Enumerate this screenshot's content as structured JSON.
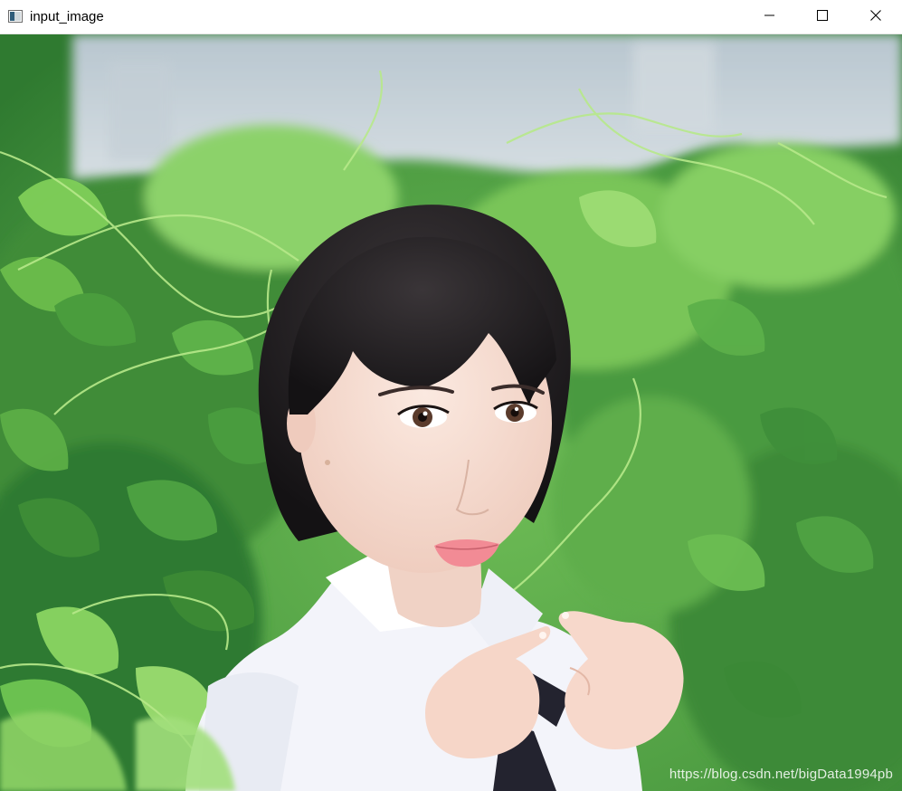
{
  "window": {
    "title": "input_image",
    "app_icon": "image-window-icon",
    "controls": {
      "minimize_icon": "minimize-icon",
      "maximize_icon": "maximize-icon",
      "close_icon": "close-icon"
    }
  },
  "image": {
    "subject": "photo",
    "watermark": "https://blog.csdn.net/bigData1994pb"
  },
  "colors": {
    "foliage_dark": "#3f8f3a",
    "foliage_light": "#8fd36a",
    "hair": "#1e1b1f",
    "skin": "#f7dcd0",
    "shirt": "#f4f5fa",
    "tie": "#23232f",
    "sky": "#c9d4dc"
  }
}
